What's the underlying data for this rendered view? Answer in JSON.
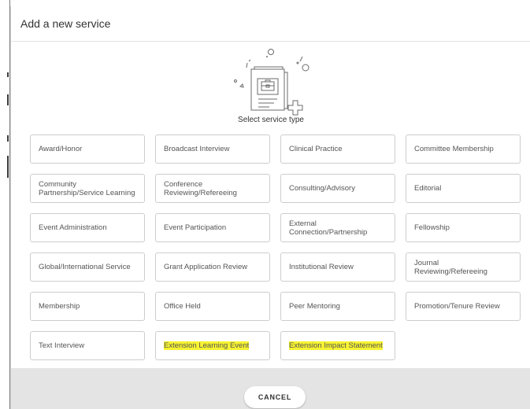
{
  "dialog": {
    "title": "Add a new service",
    "prompt": "Select service type",
    "cancel_label": "CANCEL"
  },
  "services": [
    {
      "label": "Award/Honor",
      "highlighted": false
    },
    {
      "label": "Broadcast Interview",
      "highlighted": false
    },
    {
      "label": "Clinical Practice",
      "highlighted": false
    },
    {
      "label": "Committee Membership",
      "highlighted": false
    },
    {
      "label": "Community Partnership/Service Learning",
      "highlighted": false
    },
    {
      "label": "Conference Reviewing/Refereeing",
      "highlighted": false
    },
    {
      "label": "Consulting/Advisory",
      "highlighted": false
    },
    {
      "label": "Editorial",
      "highlighted": false
    },
    {
      "label": "Event Administration",
      "highlighted": false
    },
    {
      "label": "Event Participation",
      "highlighted": false
    },
    {
      "label": "External Connection/Partnership",
      "highlighted": false
    },
    {
      "label": "Fellowship",
      "highlighted": false
    },
    {
      "label": "Global/International Service",
      "highlighted": false
    },
    {
      "label": "Grant Application Review",
      "highlighted": false
    },
    {
      "label": "Institutional Review",
      "highlighted": false
    },
    {
      "label": "Journal Reviewing/Refereeing",
      "highlighted": false
    },
    {
      "label": "Membership",
      "highlighted": false
    },
    {
      "label": "Office Held",
      "highlighted": false
    },
    {
      "label": "Peer Mentoring",
      "highlighted": false
    },
    {
      "label": "Promotion/Tenure Review",
      "highlighted": false
    },
    {
      "label": "Text Interview",
      "highlighted": false
    },
    {
      "label": "Extension Learning Event",
      "highlighted": true
    },
    {
      "label": "Extension Impact Statement",
      "highlighted": true
    }
  ],
  "colors": {
    "highlight": "#f7f331",
    "footer_bg": "#e4e4e4",
    "tile_border": "#cdcdcd"
  },
  "icons": {
    "illustration": "briefcase-document-add-icon"
  }
}
